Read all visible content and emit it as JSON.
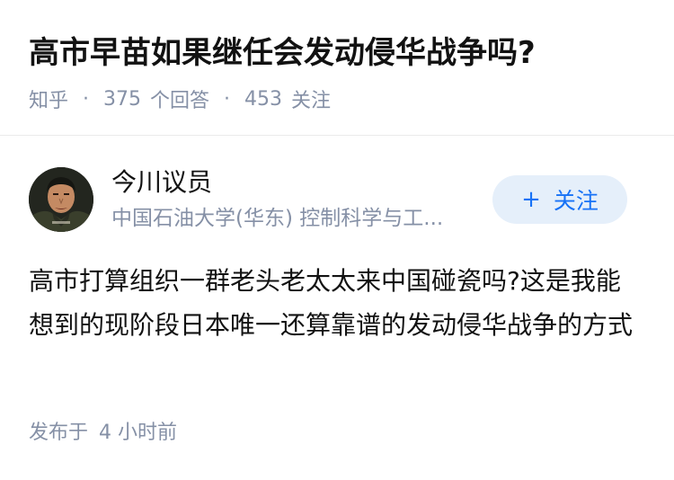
{
  "question": {
    "title": "高市早苗如果继任会发动侵华战争吗?",
    "meta": {
      "site": "知乎",
      "separator": "·",
      "answer_count": "375",
      "answer_label": "个回答",
      "follower_count": "453",
      "follower_label": "关注"
    }
  },
  "answer": {
    "author": {
      "name": "今川议员",
      "headline": "中国石油大学(华东) 控制科学与工..."
    },
    "follow_button": {
      "icon": "+",
      "label": "关注"
    },
    "content": "高市打算组织一群老头老太太来中国碰瓷吗?这是我能想到的现阶段日本唯一还算靠谱的发动侵华战争的方式",
    "footer": {
      "prefix": "发布于",
      "time": "4 小时前"
    }
  },
  "colors": {
    "title": "#121212",
    "meta": "#8590a6",
    "accent": "#1772f6",
    "follow_bg": "#e5effa",
    "divider": "#ebebeb"
  }
}
